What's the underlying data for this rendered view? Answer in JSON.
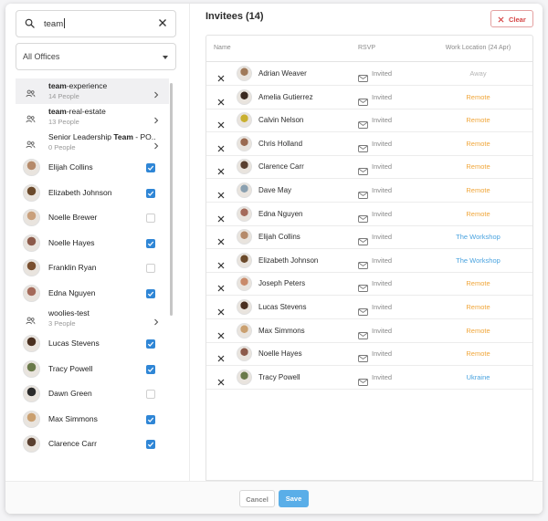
{
  "search": {
    "value": "team"
  },
  "office_filter": {
    "selected": "All Offices"
  },
  "sidebar": {
    "items": [
      {
        "type": "group",
        "name_bold": "team",
        "name_rest": "-experience",
        "count": "14 People",
        "selected": true
      },
      {
        "type": "group",
        "name_bold": "team",
        "name_rest": "-real-estate",
        "count": "13 People"
      },
      {
        "type": "group",
        "name_pre": "Senior Leadership ",
        "name_bold": "Team",
        "name_rest": " - PO...",
        "count": "0 People"
      },
      {
        "type": "person",
        "name": "Elijah Collins",
        "checked": true,
        "avatar": "#b58a6a"
      },
      {
        "type": "person",
        "name": "Elizabeth Johnson",
        "checked": true,
        "avatar": "#6b4a2b"
      },
      {
        "type": "person",
        "name": "Noelle Brewer",
        "checked": false,
        "avatar": "#c9a07c"
      },
      {
        "type": "person",
        "name": "Noelle Hayes",
        "checked": true,
        "avatar": "#8c5a4a"
      },
      {
        "type": "person",
        "name": "Franklin Ryan",
        "checked": false,
        "avatar": "#7a5030"
      },
      {
        "type": "person",
        "name": "Edna Nguyen",
        "checked": true,
        "avatar": "#a46a5a"
      },
      {
        "type": "group",
        "name_rest": "woolies-test",
        "count": "3 People"
      },
      {
        "type": "person",
        "name": "Lucas Stevens",
        "checked": true,
        "avatar": "#4a3020"
      },
      {
        "type": "person",
        "name": "Tracy Powell",
        "checked": true,
        "avatar": "#6a7a4a"
      },
      {
        "type": "person",
        "name": "Dawn Green",
        "checked": false,
        "avatar": "#2b2b2b"
      },
      {
        "type": "person",
        "name": "Max Simmons",
        "checked": true,
        "avatar": "#caa070"
      },
      {
        "type": "person",
        "name": "Clarence Carr",
        "checked": true,
        "avatar": "#5a4030"
      }
    ]
  },
  "invitees": {
    "title": "Invitees (14)",
    "clear_label": "Clear",
    "columns": {
      "name": "Name",
      "rsvp": "RSVP",
      "location": "Work Location (24 Apr)"
    },
    "rows": [
      {
        "name": "Adrian Weaver",
        "rsvp": "Invited",
        "location": "Away",
        "loc_color": "#b5b5b5",
        "avatar": "#a07a5a"
      },
      {
        "name": "Amelia Gutierrez",
        "rsvp": "Invited",
        "location": "Remote",
        "loc_color": "#f0a63a",
        "avatar": "#3a2a20"
      },
      {
        "name": "Calvin Nelson",
        "rsvp": "Invited",
        "location": "Remote",
        "loc_color": "#f0a63a",
        "avatar": "#c9b030"
      },
      {
        "name": "Chris Holland",
        "rsvp": "Invited",
        "location": "Remote",
        "loc_color": "#f0a63a",
        "avatar": "#9a6a50"
      },
      {
        "name": "Clarence Carr",
        "rsvp": "Invited",
        "location": "Remote",
        "loc_color": "#f0a63a",
        "avatar": "#5a4030"
      },
      {
        "name": "Dave May",
        "rsvp": "Invited",
        "location": "Remote",
        "loc_color": "#f0a63a",
        "avatar": "#8aa0b0"
      },
      {
        "name": "Edna Nguyen",
        "rsvp": "Invited",
        "location": "Remote",
        "loc_color": "#f0a63a",
        "avatar": "#a46a5a"
      },
      {
        "name": "Elijah Collins",
        "rsvp": "Invited",
        "location": "The Workshop",
        "loc_color": "#4aa3df",
        "avatar": "#b58a6a"
      },
      {
        "name": "Elizabeth Johnson",
        "rsvp": "Invited",
        "location": "The Workshop",
        "loc_color": "#4aa3df",
        "avatar": "#6b4a2b"
      },
      {
        "name": "Joseph Peters",
        "rsvp": "Invited",
        "location": "Remote",
        "loc_color": "#f0a63a",
        "avatar": "#c98a6a"
      },
      {
        "name": "Lucas Stevens",
        "rsvp": "Invited",
        "location": "Remote",
        "loc_color": "#f0a63a",
        "avatar": "#4a3020"
      },
      {
        "name": "Max Simmons",
        "rsvp": "Invited",
        "location": "Remote",
        "loc_color": "#f0a63a",
        "avatar": "#caa070"
      },
      {
        "name": "Noelle Hayes",
        "rsvp": "Invited",
        "location": "Remote",
        "loc_color": "#f0a63a",
        "avatar": "#8c5a4a"
      },
      {
        "name": "Tracy Powell",
        "rsvp": "Invited",
        "location": "Ukraine",
        "loc_color": "#4aa3df",
        "avatar": "#6a7a4a"
      }
    ]
  },
  "footer": {
    "cancel_label": "Cancel",
    "save_label": "Save"
  },
  "icons": {
    "search": "magnifier-icon",
    "clear_search": "close-icon",
    "dropdown": "caret-down-icon",
    "group": "people-group-icon",
    "expand": "chevron-right-icon",
    "checkbox": "check-icon",
    "remove": "close-icon",
    "rsvp": "envelope-icon"
  },
  "colors": {
    "accent": "#2f86d6",
    "remote": "#f0a63a",
    "office": "#4aa3df",
    "away": "#b5b5b5",
    "danger": "#d64545",
    "save": "#5aaee8"
  }
}
